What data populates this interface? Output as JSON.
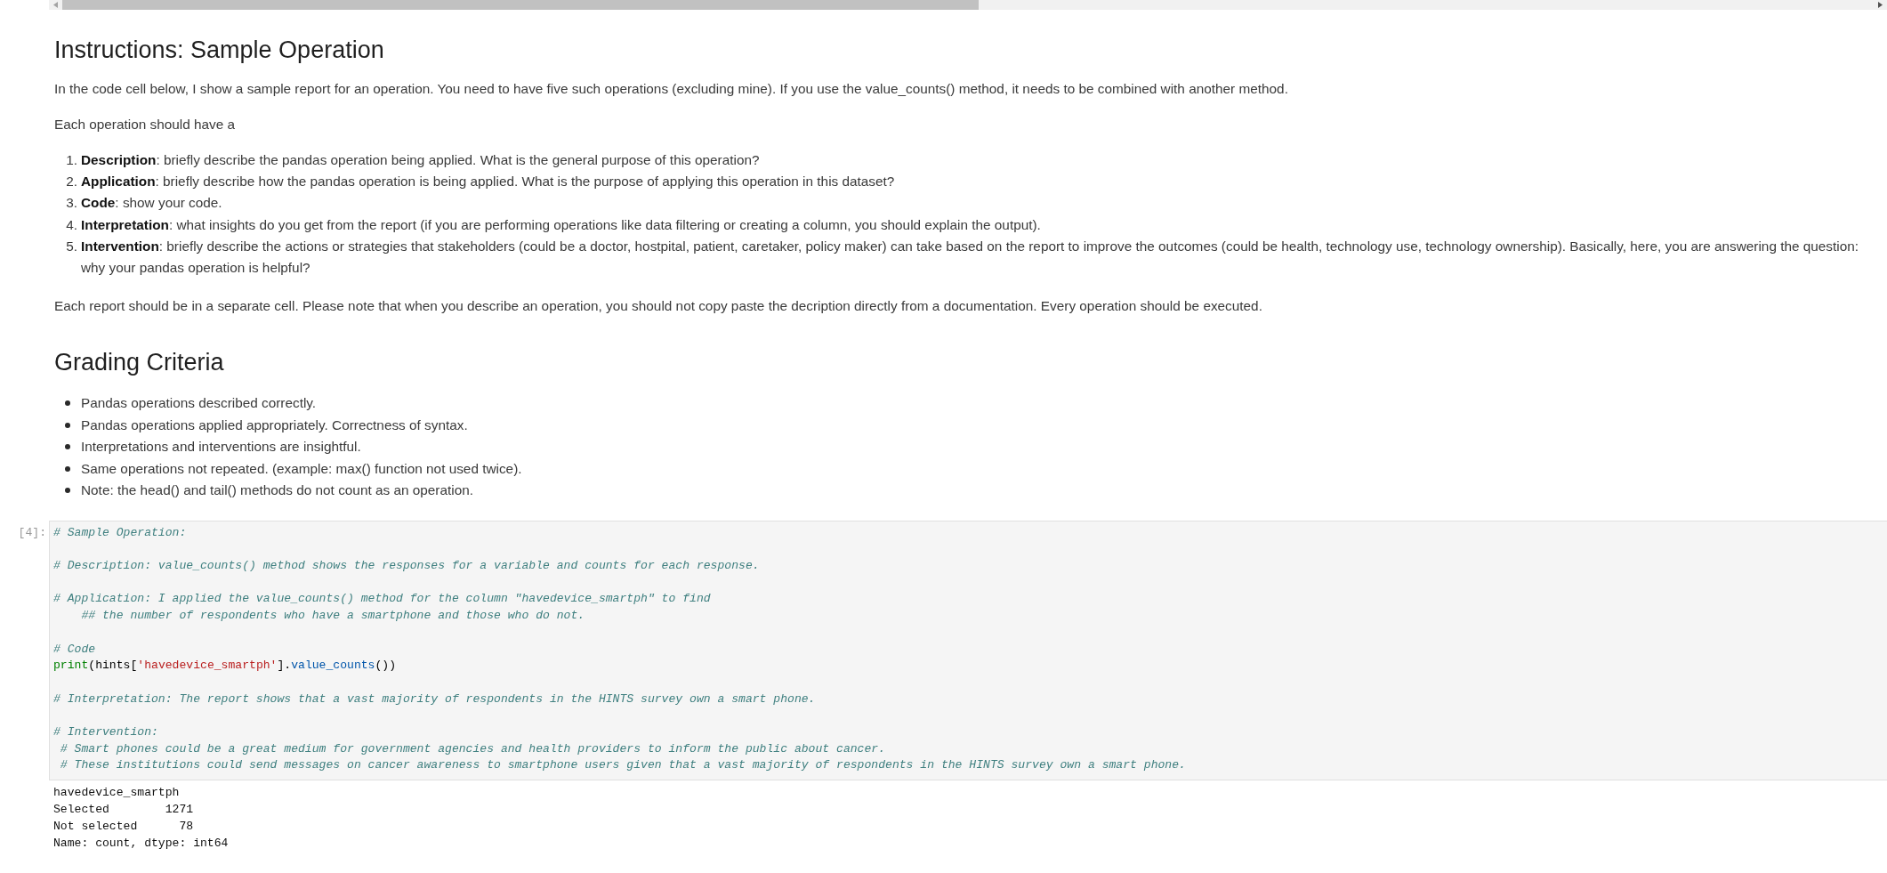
{
  "markdown_cell": {
    "heading": "Instructions: Sample Operation",
    "intro": "In the code cell below, I show a sample report for an operation. You need to have five such operations (excluding mine). If you use the value_counts() method, it needs to be combined with another method.",
    "lead_in": "Each operation should have a",
    "steps": [
      {
        "number": "1.",
        "text": "**Description**: briefly describe the pandas operation being applied. What is the general purpose of this operation?"
      },
      {
        "number": "2.",
        "text": "**Application**: briefly describe how the pandas operation is being applied. What is the purpose of applying this operation in this dataset?"
      },
      {
        "number": "3.",
        "text": "**Code**: show your code."
      },
      {
        "number": "4.",
        "text": "**Interpretation**: what insights do you get from the report (if you are performing operations like data filtering or creating a column, you should explain the output)."
      },
      {
        "number": "5.",
        "text": "**Intervention**: briefly describe the actions or strategies that stakeholders (could be a doctor, hostpital, patient, caretaker, policy maker) can take based on the report to improve the outcomes (could be health, technology use, technology ownership). Basically, here, you are answering the question: why your pandas operation is helpful?"
      }
    ],
    "closing": "Each report should be in a separate cell. Please note that when you describe an operation, you should not copy paste the decription directly from a documentation. Every operation should be executed."
  },
  "grading_cell": {
    "heading": "Grading Criteria",
    "criteria": [
      "Pandas operations described correctly.",
      "Pandas operations applied appropriately. Correctness of syntax.",
      "Interpretations and interventions are insightful.",
      "Same operations not repeated. (example: max() function not used twice).",
      "Note: the head() and tail() methods do not count as an operation."
    ]
  },
  "code_cell": {
    "prompt": "[4]:",
    "blocks": [
      {
        "lines": [
          {
            "tokens": [
              {
                "kind": "comment",
                "text": "# Sample Operation:"
              }
            ]
          }
        ]
      },
      {
        "lines": [
          {
            "tokens": [
              {
                "kind": "comment",
                "text": "# Description: value_counts() method shows the responses for a variable and counts for each response."
              }
            ]
          }
        ]
      },
      {
        "lines": [
          {
            "tokens": [
              {
                "kind": "comment",
                "text": "# Application: I applied the value_counts() method for the column \"havedevice_smartph\" to find"
              }
            ]
          },
          {
            "tokens": [
              {
                "kind": "comment",
                "text": "    ## the number of respondents who have a smartphone and those who do not."
              }
            ]
          }
        ]
      },
      {
        "lines": [
          {
            "tokens": [
              {
                "kind": "comment",
                "text": "# Code"
              }
            ]
          },
          {
            "tokens": [
              {
                "kind": "builtin",
                "text": "print"
              },
              {
                "kind": "plain",
                "text": "(hints["
              },
              {
                "kind": "string",
                "text": "'havedevice_smartph'"
              },
              {
                "kind": "plain",
                "text": "]."
              },
              {
                "kind": "attribute",
                "text": "value_counts"
              },
              {
                "kind": "plain",
                "text": "())"
              }
            ]
          }
        ]
      },
      {
        "lines": [
          {
            "tokens": [
              {
                "kind": "comment",
                "text": "# Interpretation: The report shows that a vast majority of respondents in the HINTS survey own a smart phone."
              }
            ]
          }
        ]
      },
      {
        "lines": [
          {
            "tokens": [
              {
                "kind": "comment",
                "text": "# Intervention:"
              }
            ]
          },
          {
            "tokens": [
              {
                "kind": "comment",
                "text": " # Smart phones could be a great medium for government agencies and health providers to inform the public about cancer."
              }
            ]
          },
          {
            "tokens": [
              {
                "kind": "comment",
                "text": " # These institutions could send messages on cancer awareness to smartphone users given that a vast majority of respondents in the HINTS survey own a smart phone."
              }
            ]
          }
        ]
      }
    ],
    "output": [
      "havedevice_smartph",
      "Selected        1271",
      "Not selected      78",
      "Name: count, dtype: int64"
    ]
  }
}
